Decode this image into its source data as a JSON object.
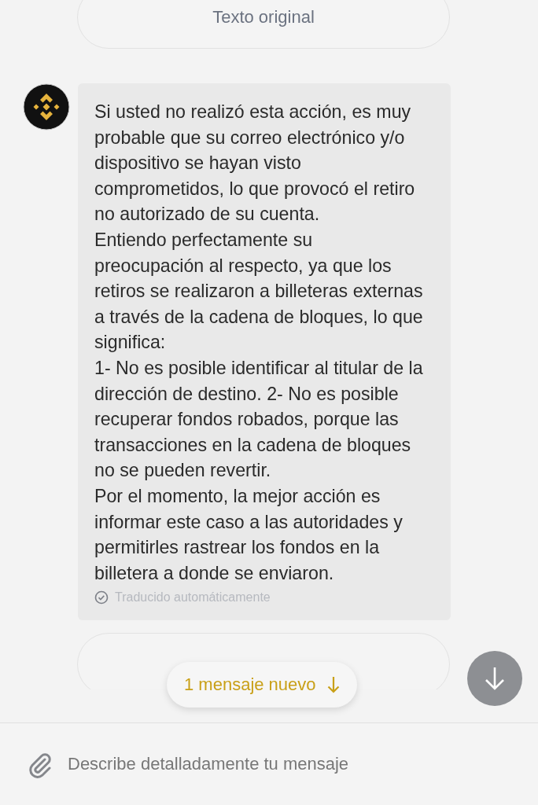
{
  "top_button": {
    "label": "Texto original"
  },
  "message": {
    "paragraphs": [
      "Si usted no realizó esta acción, es muy probable que su correo electrónico y/o dispositivo se hayan visto comprometidos, lo que provocó el retiro no autorizado de su cuenta.",
      "Entiendo perfectamente su preocupación al respecto, ya que los retiros se realizaron a billeteras externas a través de la cadena de bloques, lo que significa:",
      "1- No es posible identificar al titular de la dirección de destino. 2- No es posible recuperar fondos robados, porque las transacciones en la cadena de bloques no se pueden revertir.",
      "Por el momento, la mejor acción es informar este caso a las autoridades y permitirles rastrear los fondos en la billetera a donde se enviaron."
    ],
    "note": "Traducido automáticamente"
  },
  "new_messages": {
    "label": "1 mensaje nuevo"
  },
  "composer": {
    "placeholder": "Describe detalladamente tu mensaje"
  }
}
